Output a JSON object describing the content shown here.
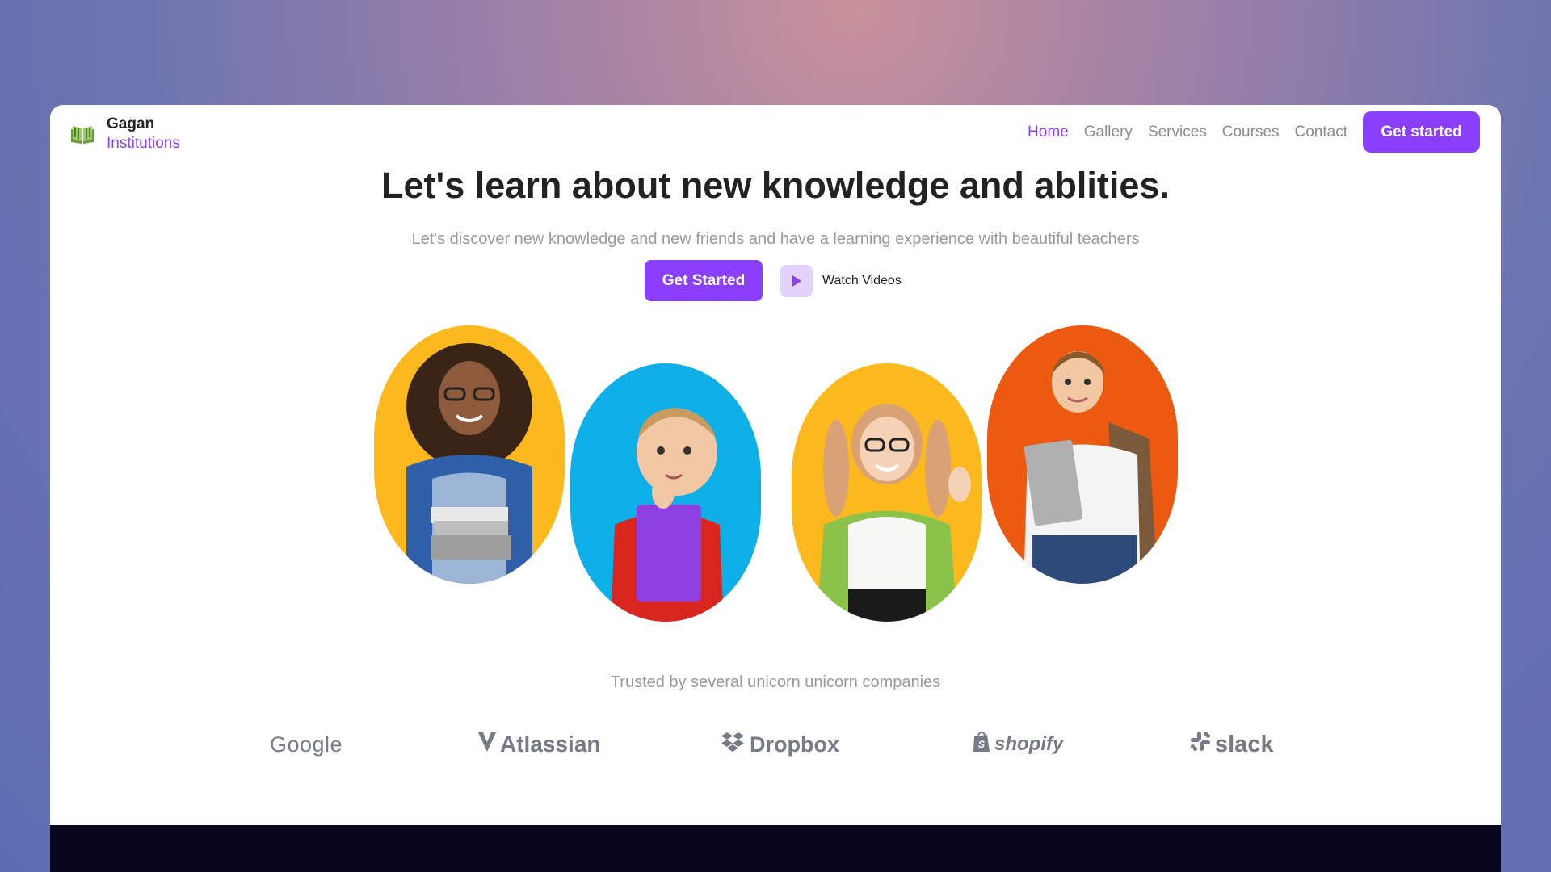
{
  "brand": {
    "name": "Gagan",
    "sub": "Institutions",
    "icon": "open-book-icon"
  },
  "nav": {
    "links": [
      "Home",
      "Gallery",
      "Services",
      "Courses",
      "Contact"
    ],
    "active": "Home",
    "cta": "Get started"
  },
  "hero": {
    "title": "Let's learn about new knowledge and ablities.",
    "subtitle": "Let's discover new knowledge and new friends and have a learning experience with beautiful teachers",
    "primary_button": "Get Started",
    "watch_label": "Watch Videos",
    "watch_icon": "play-icon"
  },
  "kids": [
    {
      "bg": "#fbb91d",
      "description": "girl-with-books"
    },
    {
      "bg": "#0fb0e8",
      "description": "boy-thinking"
    },
    {
      "bg": "#fbb91d",
      "description": "girl-with-glasses"
    },
    {
      "bg": "#ec5a12",
      "description": "boy-with-laptop"
    }
  ],
  "trusted": {
    "text": "Trusted by several unicorn unicorn companies",
    "logos": [
      "Google",
      "Atlassian",
      "Dropbox",
      "shopify",
      "slack"
    ]
  },
  "colors": {
    "accent": "#8a3ffc",
    "text": "#222222",
    "muted": "#9a9a9a",
    "footer": "#070720"
  }
}
